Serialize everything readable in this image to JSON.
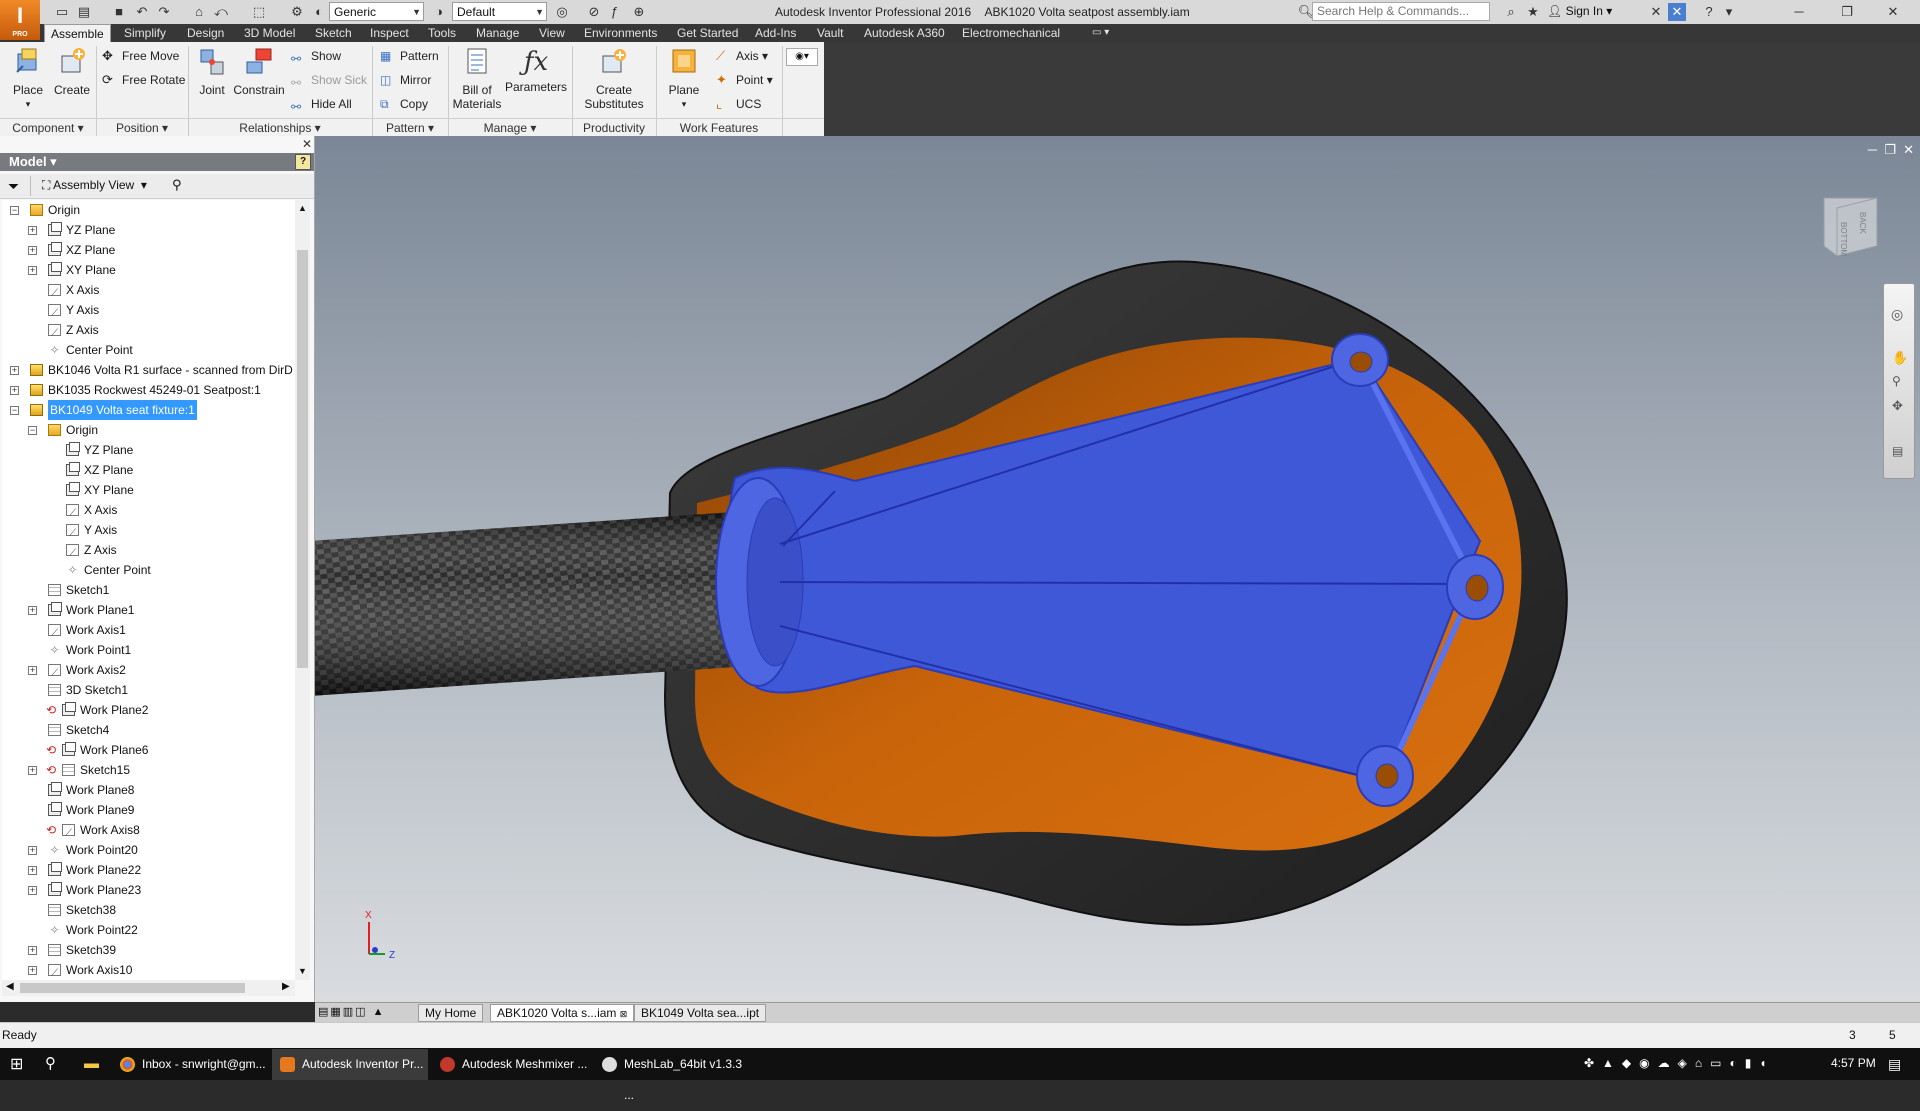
{
  "titlebar": {
    "app_title": "Autodesk Inventor Professional 2016",
    "doc_title": "ABK1020 Volta seatpost assembly.iam",
    "material_combo": "Generic",
    "appearance_combo": "Default",
    "search_placeholder": "Search Help & Commands...",
    "sign_in": "Sign In",
    "logo_label": "PRO"
  },
  "ribbon_tabs": [
    "Assemble",
    "Simplify",
    "Design",
    "3D Model",
    "Sketch",
    "Inspect",
    "Tools",
    "Manage",
    "View",
    "Environments",
    "Get Started",
    "Add-Ins",
    "Vault",
    "Autodesk A360",
    "Electromechanical"
  ],
  "ribbon": {
    "place": "Place",
    "create": "Create",
    "free_move": "Free Move",
    "free_rotate": "Free Rotate",
    "joint": "Joint",
    "constrain": "Constrain",
    "show": "Show",
    "show_sick": "Show Sick",
    "hide_all": "Hide All",
    "pattern": "Pattern",
    "mirror": "Mirror",
    "copy": "Copy",
    "bom_line1": "Bill of",
    "bom_line2": "Materials",
    "parameters": "Parameters",
    "create_sub_line1": "Create",
    "create_sub_line2": "Substitutes",
    "plane": "Plane",
    "axis": "Axis",
    "point": "Point",
    "ucs": "UCS",
    "groups": {
      "component": "Component",
      "position": "Position",
      "relationships": "Relationships",
      "pattern": "Pattern",
      "manage": "Manage",
      "productivity": "Productivity",
      "work_features": "Work Features"
    }
  },
  "browser": {
    "title": "Model",
    "view_mode": "Assembly View",
    "help": "?",
    "tree": [
      {
        "label": "Origin",
        "depth": 0,
        "icon": "folder",
        "exp": "-"
      },
      {
        "label": "YZ Plane",
        "depth": 1,
        "icon": "plane",
        "exp": "+"
      },
      {
        "label": "XZ Plane",
        "depth": 1,
        "icon": "plane",
        "exp": "+"
      },
      {
        "label": "XY Plane",
        "depth": 1,
        "icon": "plane",
        "exp": "+"
      },
      {
        "label": "X Axis",
        "depth": 1,
        "icon": "axis",
        "exp": ""
      },
      {
        "label": "Y Axis",
        "depth": 1,
        "icon": "axis",
        "exp": ""
      },
      {
        "label": "Z Axis",
        "depth": 1,
        "icon": "axis",
        "exp": ""
      },
      {
        "label": "Center Point",
        "depth": 1,
        "icon": "point",
        "exp": ""
      },
      {
        "label": "BK1046 Volta R1 surface - scanned from DirD",
        "depth": 0,
        "icon": "part",
        "exp": "+"
      },
      {
        "label": "BK1035 Rockwest 45249-01 Seatpost:1",
        "depth": 0,
        "icon": "part",
        "exp": "+"
      },
      {
        "label": "BK1049 Volta seat fixture:1",
        "depth": 0,
        "icon": "part",
        "exp": "-",
        "selected": true
      },
      {
        "label": "Origin",
        "depth": 1,
        "icon": "folder",
        "exp": "-"
      },
      {
        "label": "YZ Plane",
        "depth": 2,
        "icon": "plane",
        "exp": ""
      },
      {
        "label": "XZ Plane",
        "depth": 2,
        "icon": "plane",
        "exp": ""
      },
      {
        "label": "XY Plane",
        "depth": 2,
        "icon": "plane",
        "exp": ""
      },
      {
        "label": "X Axis",
        "depth": 2,
        "icon": "axis",
        "exp": ""
      },
      {
        "label": "Y Axis",
        "depth": 2,
        "icon": "axis",
        "exp": ""
      },
      {
        "label": "Z Axis",
        "depth": 2,
        "icon": "axis",
        "exp": ""
      },
      {
        "label": "Center Point",
        "depth": 2,
        "icon": "point",
        "exp": ""
      },
      {
        "label": "Sketch1",
        "depth": 1,
        "icon": "sketch",
        "exp": ""
      },
      {
        "label": "Work Plane1",
        "depth": 1,
        "icon": "plane",
        "exp": "+"
      },
      {
        "label": "Work Axis1",
        "depth": 1,
        "icon": "axis",
        "exp": ""
      },
      {
        "label": "Work Point1",
        "depth": 1,
        "icon": "point",
        "exp": ""
      },
      {
        "label": "Work Axis2",
        "depth": 1,
        "icon": "axis",
        "exp": "+"
      },
      {
        "label": "3D Sketch1",
        "depth": 1,
        "icon": "sketch3d",
        "exp": ""
      },
      {
        "label": "Work Plane2",
        "depth": 1,
        "icon": "plane",
        "exp": "",
        "link": true
      },
      {
        "label": "Sketch4",
        "depth": 1,
        "icon": "sketch",
        "exp": ""
      },
      {
        "label": "Work Plane6",
        "depth": 1,
        "icon": "plane",
        "exp": "",
        "link": true
      },
      {
        "label": "Sketch15",
        "depth": 1,
        "icon": "sketch",
        "exp": "+",
        "link": true
      },
      {
        "label": "Work Plane8",
        "depth": 1,
        "icon": "plane",
        "exp": ""
      },
      {
        "label": "Work Plane9",
        "depth": 1,
        "icon": "plane",
        "exp": ""
      },
      {
        "label": "Work Axis8",
        "depth": 1,
        "icon": "axis",
        "exp": "",
        "link": true
      },
      {
        "label": "Work Point20",
        "depth": 1,
        "icon": "point",
        "exp": "+"
      },
      {
        "label": "Work Plane22",
        "depth": 1,
        "icon": "plane",
        "exp": "+"
      },
      {
        "label": "Work Plane23",
        "depth": 1,
        "icon": "plane",
        "exp": "+"
      },
      {
        "label": "Sketch38",
        "depth": 1,
        "icon": "sketch",
        "exp": ""
      },
      {
        "label": "Work Point22",
        "depth": 1,
        "icon": "point",
        "exp": ""
      },
      {
        "label": "Sketch39",
        "depth": 1,
        "icon": "sketch",
        "exp": "+"
      },
      {
        "label": "Work Axis10",
        "depth": 1,
        "icon": "axis",
        "exp": "+"
      }
    ]
  },
  "viewcube": {
    "face_back": "BACK",
    "face_bottom": "BOTTOM"
  },
  "triad": {
    "x": "X",
    "z": "Z"
  },
  "doc_tabs": [
    "My Home",
    "ABK1020 Volta s...iam",
    "BK1049 Volta sea...ipt"
  ],
  "status": {
    "text": "Ready",
    "count1": "3",
    "count2": "5"
  },
  "taskbar": {
    "apps": [
      "Inbox - snwright@gm...",
      "Autodesk Inventor Pr...",
      "Autodesk Meshmixer ...",
      "MeshLab_64bit v1.3.3 ..."
    ],
    "clock": "4:57 PM"
  },
  "colors": {
    "accent": "#f08a28",
    "selection": "#3399ff",
    "fixture_blue": "#3f58d8",
    "saddle_orange": "#c9640a"
  }
}
